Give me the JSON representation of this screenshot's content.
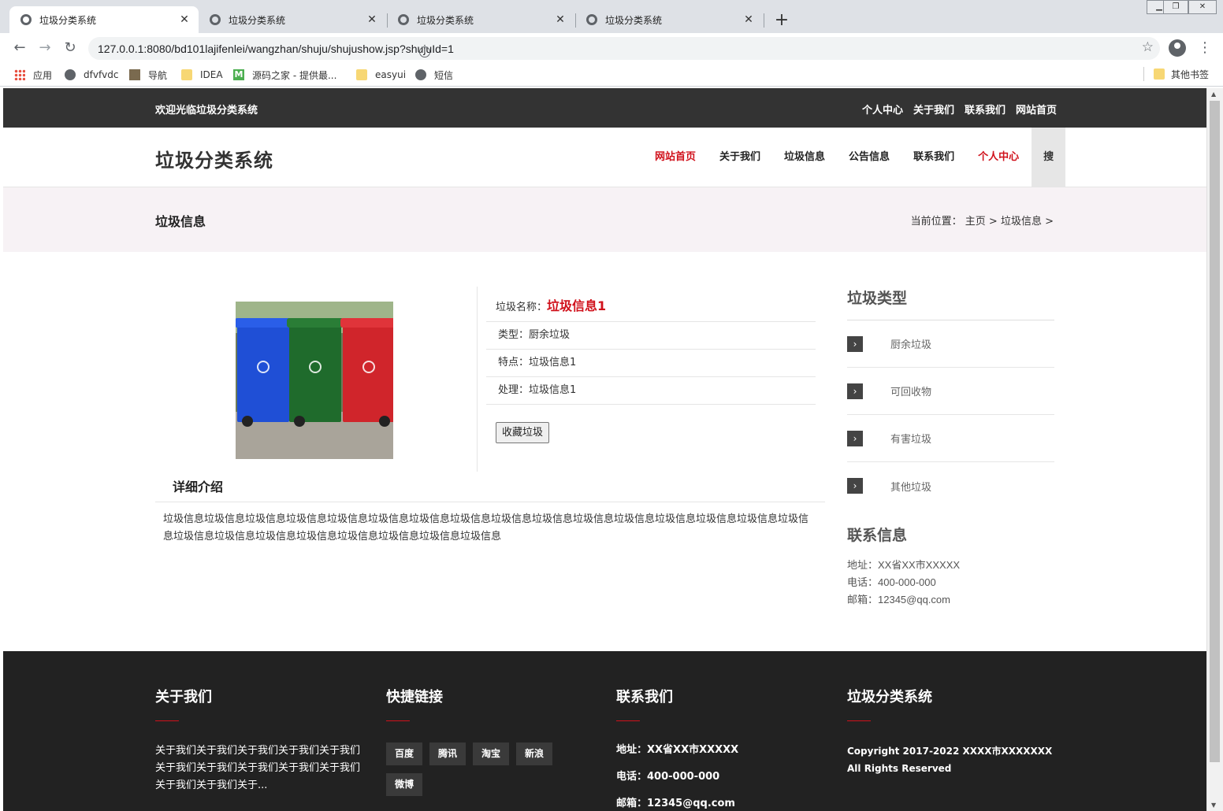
{
  "browser": {
    "tabs": [
      {
        "title": "垃圾分类系统"
      },
      {
        "title": "垃圾分类系统"
      },
      {
        "title": "垃圾分类系统"
      },
      {
        "title": "垃圾分类系统"
      }
    ],
    "url": "127.0.0.1:8080/bd101lajifenlei/wangzhan/shuju/shujushow.jsp?shujuId=1",
    "bookmarks": [
      "应用",
      "dfvfvdc",
      "导航",
      "IDEA",
      "源码之家 - 提供最...",
      "easyui",
      "短信"
    ],
    "other_bookmarks": "其他书签"
  },
  "topbar": {
    "welcome": "欢迎光临垃圾分类系统",
    "links": [
      "个人中心",
      "关于我们",
      "联系我们",
      "网站首页"
    ]
  },
  "header": {
    "logo": "垃圾分类系统",
    "menu": [
      "网站首页",
      "关于我们",
      "垃圾信息",
      "公告信息",
      "联系我们",
      "个人中心"
    ],
    "search": "搜"
  },
  "titlebar": {
    "title": "垃圾信息",
    "breadcrumb": "当前位置： 主页 > 垃圾信息 >"
  },
  "product": {
    "name_label": "垃圾名称：",
    "name_value": "垃圾信息1",
    "type": "类型：厨余垃圾",
    "feature": "特点：垃圾信息1",
    "handling": "处理：垃圾信息1",
    "favorite_button": "收藏垃圾"
  },
  "detail": {
    "heading": "详细介绍",
    "text": "垃圾信息垃圾信息垃圾信息垃圾信息垃圾信息垃圾信息垃圾信息垃圾信息垃圾信息垃圾信息垃圾信息垃圾信息垃圾信息垃圾信息垃圾信息垃圾信息垃圾信息垃圾信息垃圾信息垃圾信息垃圾信息垃圾信息垃圾信息垃圾信息"
  },
  "sidebar": {
    "categories_title": "垃圾类型",
    "categories": [
      "厨余垃圾",
      "可回收物",
      "有害垃圾",
      "其他垃圾"
    ],
    "contact_title": "联系信息",
    "address": "地址：XX省XX市XXXXX",
    "phone": "电话：400-000-000",
    "email": "邮箱：12345@qq.com"
  },
  "footer": {
    "about_title": "关于我们",
    "about_text": "关于我们关于我们关于我们关于我们关于我们关于我们关于我们关于我们关于我们关于我们关于我们关于我们关于...",
    "links_title": "快捷链接",
    "links": [
      "百度",
      "腾讯",
      "淘宝",
      "新浪",
      "微博"
    ],
    "contact_title": "联系我们",
    "address": "地址：XX省XX市XXXXX",
    "phone": "电话：400-000-000",
    "email": "邮箱：12345@qq.com",
    "site_title": "垃圾分类系统",
    "copyright": "Copyright 2017-2022 XXXX市XXXXXXX All Rights Reserved"
  },
  "colors": {
    "accent_red": "#d0111b",
    "topbar_bg": "#333333",
    "footer_bg": "#222222",
    "titlebar_bg": "#f7f2f5"
  }
}
